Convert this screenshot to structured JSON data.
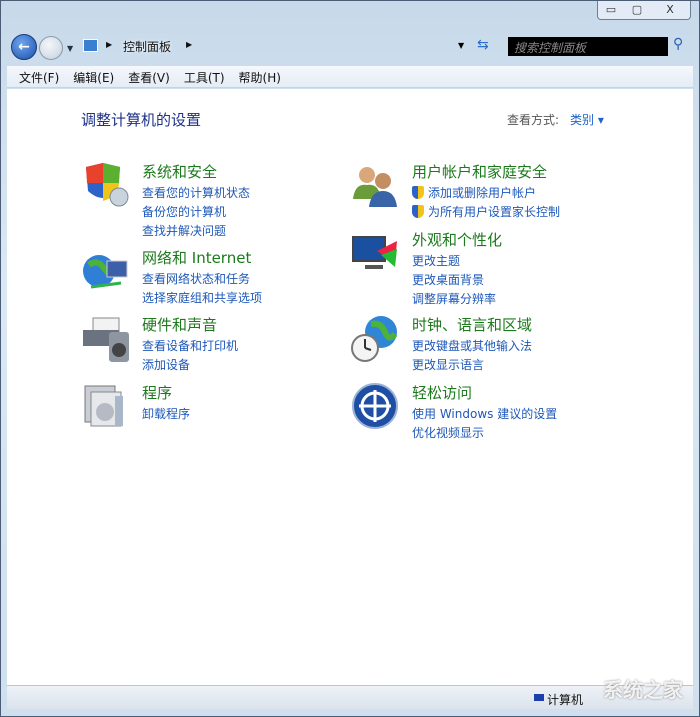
{
  "window": {
    "minimize": "▭",
    "maximize": "▢",
    "close": "X"
  },
  "address": {
    "crumb": "控制面板",
    "search_placeholder": "搜索控制面板"
  },
  "menu": [
    "文件(F)",
    "编辑(E)",
    "查看(V)",
    "工具(T)",
    "帮助(H)"
  ],
  "page": {
    "title": "调整计算机的设置",
    "view_by_label": "查看方式:",
    "view_by_value": "类别"
  },
  "categories": [
    {
      "title": "系统和安全",
      "links": [
        "查看您的计算机状态",
        "备份您的计算机",
        "查找并解决问题"
      ]
    },
    {
      "title": "网络和 Internet",
      "links": [
        "查看网络状态和任务",
        "选择家庭组和共享选项"
      ]
    },
    {
      "title": "硬件和声音",
      "links": [
        "查看设备和打印机",
        "添加设备"
      ]
    },
    {
      "title": "程序",
      "links": [
        "卸载程序"
      ]
    },
    {
      "title": "用户帐户和家庭安全",
      "links": [
        "添加或删除用户帐户",
        "为所有用户设置家长控制"
      ]
    },
    {
      "title": "外观和个性化",
      "links": [
        "更改主题",
        "更改桌面背景",
        "调整屏幕分辨率"
      ]
    },
    {
      "title": "时钟、语言和区域",
      "links": [
        "更改键盘或其他输入法",
        "更改显示语言"
      ]
    },
    {
      "title": "轻松访问",
      "links": [
        "使用 Windows 建议的设置",
        "优化视频显示"
      ]
    }
  ],
  "status": {
    "computer": "计算机"
  },
  "watermark": "系统之家"
}
